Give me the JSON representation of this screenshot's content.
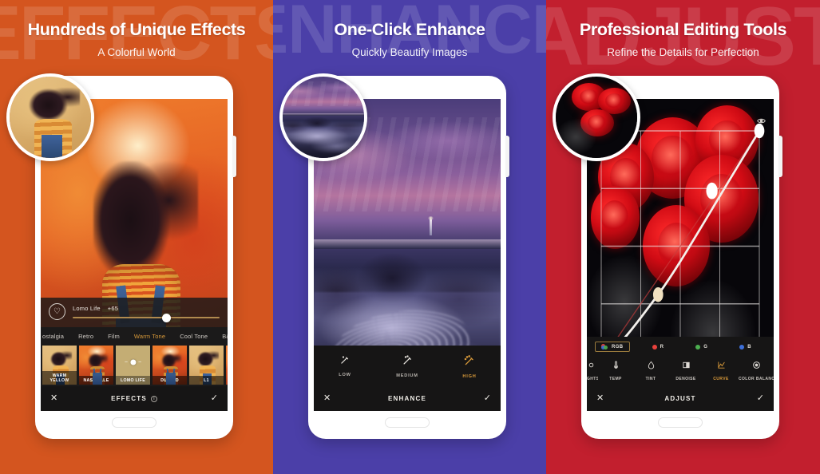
{
  "panels": [
    {
      "id": "effects",
      "accent": "#d4551f",
      "watermark": "EFFECTS",
      "title": "Hundreds of Unique Effects",
      "subtitle": "A Colorful World",
      "editor": {
        "slider": {
          "name": "Lomo Life",
          "value": "+65",
          "percent": 64
        },
        "heart_icon": "heart-icon",
        "categories": [
          {
            "label": "ostalgia",
            "selected": false
          },
          {
            "label": "Retro",
            "selected": false
          },
          {
            "label": "Film",
            "selected": false
          },
          {
            "label": "Warm Tone",
            "selected": true
          },
          {
            "label": "Cool Tone",
            "selected": false
          },
          {
            "label": "B&W",
            "selected": false
          }
        ],
        "settings_icon": "gear-icon",
        "filters": [
          {
            "label": "WARM YELLOW",
            "selected": false
          },
          {
            "label": "NASHVILLE",
            "selected": false
          },
          {
            "label": "LOMO LIFE",
            "selected": true
          },
          {
            "label": "DULLED",
            "selected": false
          },
          {
            "label": "L1",
            "selected": false
          },
          {
            "label": "",
            "selected": false
          }
        ],
        "action_bar": {
          "cancel_icon": "close-icon",
          "title": "EFFECTS",
          "info_icon": "info-icon",
          "confirm_icon": "check-icon"
        }
      }
    },
    {
      "id": "enhance",
      "accent": "#4b3fa8",
      "watermark": "ENHANCE",
      "title": "One-Click Enhance",
      "subtitle": "Quickly Beautify Images",
      "editor": {
        "levels": [
          {
            "label": "LOW",
            "icon": "magic-wand-icon",
            "selected": false
          },
          {
            "label": "MEDIUM",
            "icon": "magic-wand-icon",
            "selected": false
          },
          {
            "label": "HIGH",
            "icon": "magic-wand-icon",
            "selected": true
          }
        ],
        "action_bar": {
          "cancel_icon": "close-icon",
          "title": "ENHANCE",
          "confirm_icon": "check-icon"
        }
      }
    },
    {
      "id": "adjust",
      "accent": "#c21f2e",
      "watermark": "ADJUST",
      "title": "Professional Editing Tools",
      "subtitle": "Refine the Details for Perfection",
      "editor": {
        "preview_toggle_icon": "eye-icon",
        "channels": [
          {
            "label": "RGB",
            "swatch": "",
            "selected": true
          },
          {
            "label": "R",
            "swatch": "#e8413c",
            "selected": false
          },
          {
            "label": "G",
            "swatch": "#4caf50",
            "selected": false
          },
          {
            "label": "B",
            "swatch": "#3d6fd8",
            "selected": false
          }
        ],
        "tools": [
          {
            "label": "GHTS",
            "icon": "highlights-icon",
            "selected": false
          },
          {
            "label": "TEMP",
            "icon": "thermometer-icon",
            "selected": false
          },
          {
            "label": "TINT",
            "icon": "droplet-icon",
            "selected": false
          },
          {
            "label": "DENOISE",
            "icon": "denoise-icon",
            "selected": false
          },
          {
            "label": "CURVE",
            "icon": "curve-icon",
            "selected": true
          },
          {
            "label": "COLOR BALANCE",
            "icon": "color-balance-icon",
            "selected": false
          }
        ],
        "curve": {
          "grid_divisions": 4,
          "points": [
            [
              0,
              0
            ],
            [
              0.36,
              0.29
            ],
            [
              0.7,
              0.74
            ],
            [
              1,
              1
            ]
          ]
        },
        "action_bar": {
          "cancel_icon": "close-icon",
          "title": "ADJUST",
          "confirm_icon": "check-icon"
        }
      }
    }
  ]
}
